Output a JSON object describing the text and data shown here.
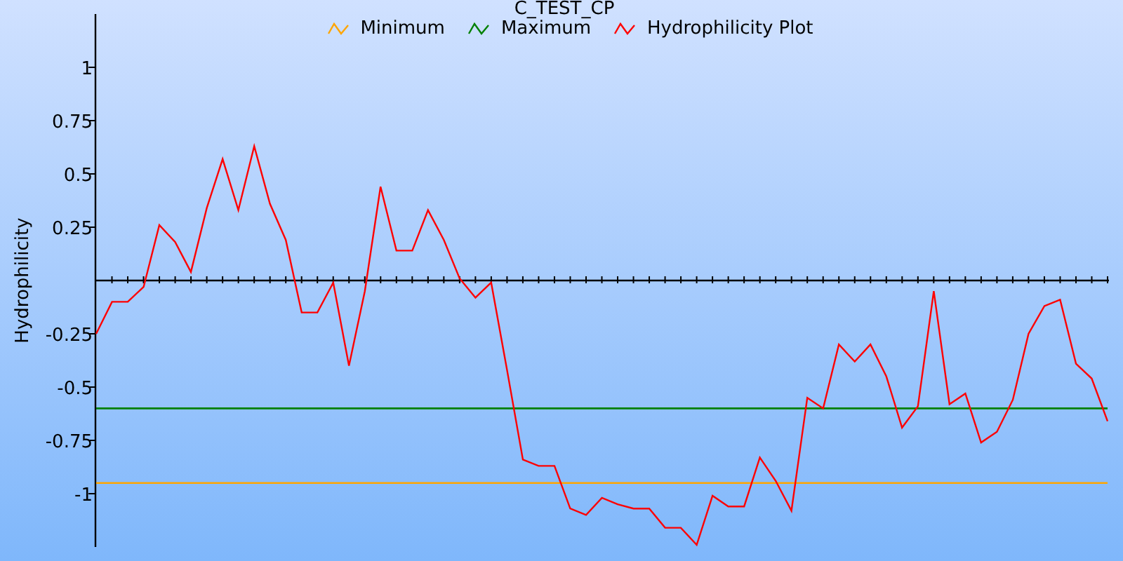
{
  "chart_data": {
    "type": "line",
    "title": "C_TEST_CP",
    "legend": true,
    "ylabel": "Hydrophilicity",
    "ylim": [
      -1.25,
      1.25
    ],
    "yticks": [
      1,
      0.75,
      0.5,
      0.25,
      -0.25,
      -0.5,
      -0.75,
      -1
    ],
    "series": [
      {
        "name": "Minimum",
        "color": "#ffa500",
        "values": [
          -0.95,
          -0.95,
          -0.95,
          -0.95,
          -0.95,
          -0.95,
          -0.95,
          -0.95,
          -0.95,
          -0.95,
          -0.95,
          -0.95,
          -0.95,
          -0.95,
          -0.95,
          -0.95,
          -0.95,
          -0.95,
          -0.95,
          -0.95,
          -0.95,
          -0.95,
          -0.95,
          -0.95,
          -0.95,
          -0.95,
          -0.95,
          -0.95,
          -0.95,
          -0.95,
          -0.95,
          -0.95,
          -0.95,
          -0.95,
          -0.95,
          -0.95,
          -0.95,
          -0.95,
          -0.95,
          -0.95,
          -0.95,
          -0.95,
          -0.95,
          -0.95,
          -0.95,
          -0.95,
          -0.95,
          -0.95,
          -0.95,
          -0.95,
          -0.95,
          -0.95,
          -0.95,
          -0.95,
          -0.95,
          -0.95,
          -0.95,
          -0.95,
          -0.95,
          -0.95,
          -0.95,
          -0.95,
          -0.95,
          -0.95,
          -0.95
        ]
      },
      {
        "name": "Maximum",
        "color": "#008000",
        "values": [
          -0.6,
          -0.6,
          -0.6,
          -0.6,
          -0.6,
          -0.6,
          -0.6,
          -0.6,
          -0.6,
          -0.6,
          -0.6,
          -0.6,
          -0.6,
          -0.6,
          -0.6,
          -0.6,
          -0.6,
          -0.6,
          -0.6,
          -0.6,
          -0.6,
          -0.6,
          -0.6,
          -0.6,
          -0.6,
          -0.6,
          -0.6,
          -0.6,
          -0.6,
          -0.6,
          -0.6,
          -0.6,
          -0.6,
          -0.6,
          -0.6,
          -0.6,
          -0.6,
          -0.6,
          -0.6,
          -0.6,
          -0.6,
          -0.6,
          -0.6,
          -0.6,
          -0.6,
          -0.6,
          -0.6,
          -0.6,
          -0.6,
          -0.6,
          -0.6,
          -0.6,
          -0.6,
          -0.6,
          -0.6,
          -0.6,
          -0.6,
          -0.6,
          -0.6,
          -0.6,
          -0.6,
          -0.6,
          -0.6,
          -0.6,
          -0.6
        ]
      },
      {
        "name": "Hydrophilicity Plot",
        "color": "#ff0000",
        "values": [
          -0.25,
          -0.1,
          -0.1,
          -0.03,
          0.26,
          0.18,
          0.04,
          0.34,
          0.57,
          0.33,
          0.63,
          0.36,
          0.19,
          -0.15,
          -0.15,
          -0.01,
          -0.4,
          -0.05,
          0.44,
          0.14,
          0.14,
          0.33,
          0.19,
          0.01,
          -0.08,
          -0.01,
          -0.42,
          -0.84,
          -0.87,
          -0.87,
          -1.07,
          -1.1,
          -1.02,
          -1.05,
          -1.07,
          -1.07,
          -1.16,
          -1.16,
          -1.24,
          -1.01,
          -1.06,
          -1.06,
          -0.83,
          -0.94,
          -1.08,
          -0.55,
          -0.6,
          -0.3,
          -0.38,
          -0.3,
          -0.45,
          -0.69,
          -0.59,
          -0.05,
          -0.58,
          -0.53,
          -0.76,
          -0.71,
          -0.56,
          -0.25,
          -0.12,
          -0.09,
          -0.39,
          -0.46,
          -0.66
        ]
      }
    ]
  }
}
